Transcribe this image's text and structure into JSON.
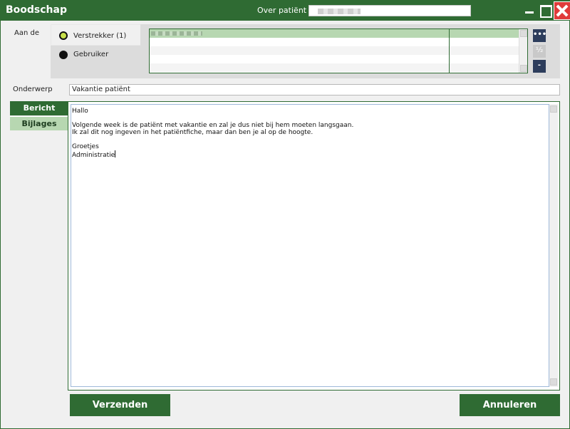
{
  "window": {
    "title": "Boodschap"
  },
  "patient": {
    "label": "Over patiënt",
    "value": ""
  },
  "recipients": {
    "label": "Aan de",
    "options": [
      {
        "label": "Verstrekker (1)",
        "selected": true
      },
      {
        "label": "Gebruiker",
        "selected": false
      }
    ],
    "side_buttons": {
      "more": "•••",
      "half": "½",
      "remove": "-"
    }
  },
  "subject": {
    "label": "Onderwerp",
    "value": "Vakantie patiënt"
  },
  "tabs": [
    {
      "label": "Bericht"
    },
    {
      "label": "Bijlages"
    }
  ],
  "message": {
    "body": "Hallo\n\nVolgende week is de patiënt met vakantie en zal je dus niet bij hem moeten langsgaan.\nIk zal dit nog ingeven in het patiëntfiche, maar dan ben je al op de hoogte.\n\nGroetjes\nAdministratie"
  },
  "actions": {
    "send": "Verzenden",
    "cancel": "Annuleren"
  },
  "colors": {
    "accent": "#2f6b33",
    "close": "#e03a3a",
    "selected_row": "#b7d7b1",
    "side_button": "#2d3d5c"
  }
}
